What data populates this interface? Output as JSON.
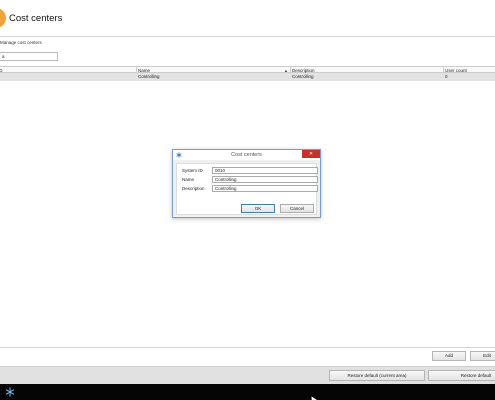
{
  "header": {
    "title": "Cost centers",
    "logo_icon": "app-logo-icon",
    "accent_color": "#f2a23a"
  },
  "section": {
    "label": "Manage cost centers",
    "search_value": "a"
  },
  "table": {
    "columns": [
      "ID",
      "Name",
      "Description",
      "User count"
    ],
    "sorted_column": "Name",
    "rows": [
      {
        "id": "",
        "name": "Controlling",
        "description": "Controlling",
        "user_count": "0"
      }
    ]
  },
  "footer": {
    "add_label": "Add",
    "edit_label": "Edit",
    "restore_area_label": "Restore default (current area)",
    "restore_label": "Restore default"
  },
  "taskbar": {
    "start_icon": "snowflake-icon"
  },
  "dialog": {
    "title": "Cost centers",
    "close_label": "✕",
    "fields": [
      {
        "label": "System ID",
        "value": "0010"
      },
      {
        "label": "Name",
        "value": "Controlling"
      },
      {
        "label": "Description",
        "value": "Controlling"
      }
    ],
    "ok_label": "OK",
    "cancel_label": "Cancel"
  }
}
